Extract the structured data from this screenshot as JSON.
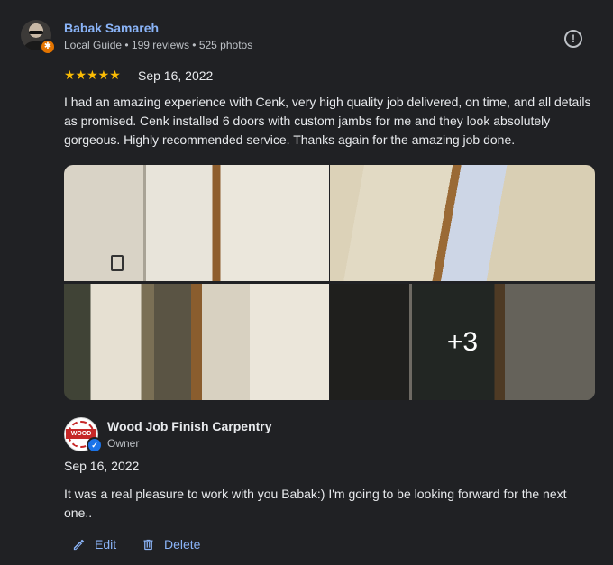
{
  "reviewer": {
    "name": "Babak Samareh",
    "meta": "Local Guide • 199 reviews • 525 photos"
  },
  "review": {
    "stars": "★★★★★",
    "rating": 5,
    "date": "Sep 16, 2022",
    "text": "I had an amazing experience with Cenk, very high quality job delivered, on time, and all details as promised. Cenk installed 6 doors with custom jambs for me and they look absolutely gorgeous. Highly recommended service. Thanks again for the amazing job done.",
    "more_photos": "+3"
  },
  "owner": {
    "logo_text": "WOOD JOB",
    "name": "Wood Job Finish Carpentry",
    "role": "Owner",
    "reply_date": "Sep 16, 2022",
    "reply_text": "It was a real pleasure to work with you Babak:) I'm going to be looking forward for the next one.."
  },
  "actions": {
    "edit": "Edit",
    "delete": "Delete"
  },
  "colors": {
    "background": "#202124",
    "link": "#8ab4f8",
    "star": "#fbbc04",
    "guide_badge": "#e37400",
    "verified": "#1a73e8"
  },
  "icons": [
    "local-guide-badge-icon",
    "report-icon",
    "star-icon",
    "verified-check-icon",
    "pencil-icon",
    "trash-icon"
  ]
}
